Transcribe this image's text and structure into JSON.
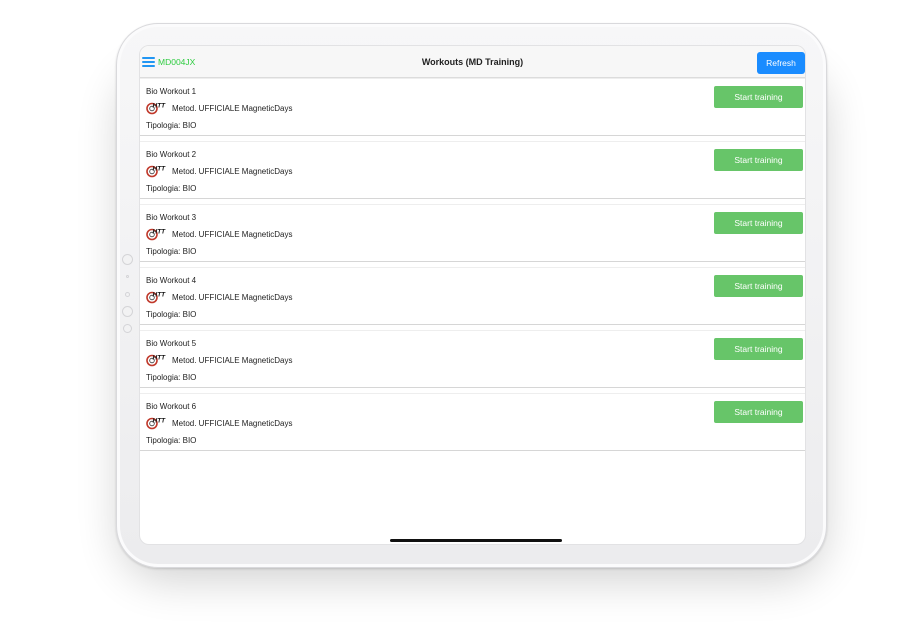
{
  "header": {
    "user_code": "MD004JX",
    "title": "Workouts (MD Training)",
    "refresh_label": "Refresh",
    "menu_icon": "hamburger-menu-icon"
  },
  "colors": {
    "accent_blue": "#1a8cff",
    "start_green": "#67c569",
    "user_code_green": "#2ecc40",
    "logo_red": "#c0392b"
  },
  "workouts": [
    {
      "name": "Bio Workout 1",
      "logo": "HTT",
      "method": "Metod. UFFICIALE MagneticDays",
      "type": "Tipologia: BIO",
      "action": "Start training"
    },
    {
      "name": "Bio Workout 2",
      "logo": "HTT",
      "method": "Metod. UFFICIALE MagneticDays",
      "type": "Tipologia: BIO",
      "action": "Start training"
    },
    {
      "name": "Bio Workout 3",
      "logo": "HTT",
      "method": "Metod. UFFICIALE MagneticDays",
      "type": "Tipologia: BIO",
      "action": "Start training"
    },
    {
      "name": "Bio Workout 4",
      "logo": "HTT",
      "method": "Metod. UFFICIALE MagneticDays",
      "type": "Tipologia: BIO",
      "action": "Start training"
    },
    {
      "name": "Bio Workout 5",
      "logo": "HTT",
      "method": "Metod. UFFICIALE MagneticDays",
      "type": "Tipologia: BIO",
      "action": "Start training"
    },
    {
      "name": "Bio Workout 6",
      "logo": "HTT",
      "method": "Metod. UFFICIALE MagneticDays",
      "type": "Tipologia: BIO",
      "action": "Start training"
    }
  ]
}
